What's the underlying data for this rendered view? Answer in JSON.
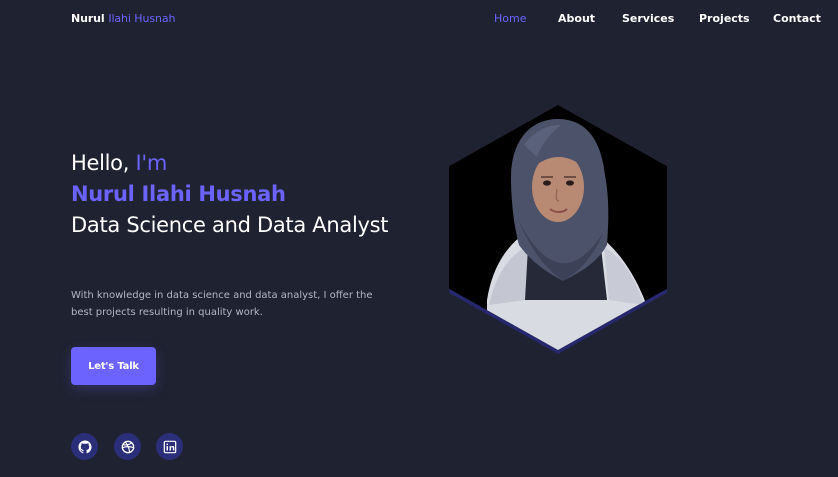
{
  "header": {
    "logo_first": "Nurul",
    "logo_rest": "Ilahi Husnah",
    "nav": [
      {
        "label": "Home",
        "active": true
      },
      {
        "label": "About",
        "active": false
      },
      {
        "label": "Services",
        "active": false
      },
      {
        "label": "Projects",
        "active": false
      },
      {
        "label": "Contact",
        "active": false
      }
    ]
  },
  "hero": {
    "greeting": "Hello,",
    "greeting_accent": "I'm",
    "name": "Nurul Ilahi Husnah",
    "role": "Data Science and Data Analyst",
    "description": "With knowledge in data science and data analyst, I offer the best projects resulting in quality work.",
    "cta_label": "Let's Talk"
  },
  "social": [
    {
      "icon": "github-icon"
    },
    {
      "icon": "dribbble-icon"
    },
    {
      "icon": "linkedin-icon"
    }
  ],
  "colors": {
    "background": "#1f2230",
    "accent": "#6c63ff",
    "icon_bg": "#2b2f7a",
    "muted_text": "#b3b6c2"
  }
}
